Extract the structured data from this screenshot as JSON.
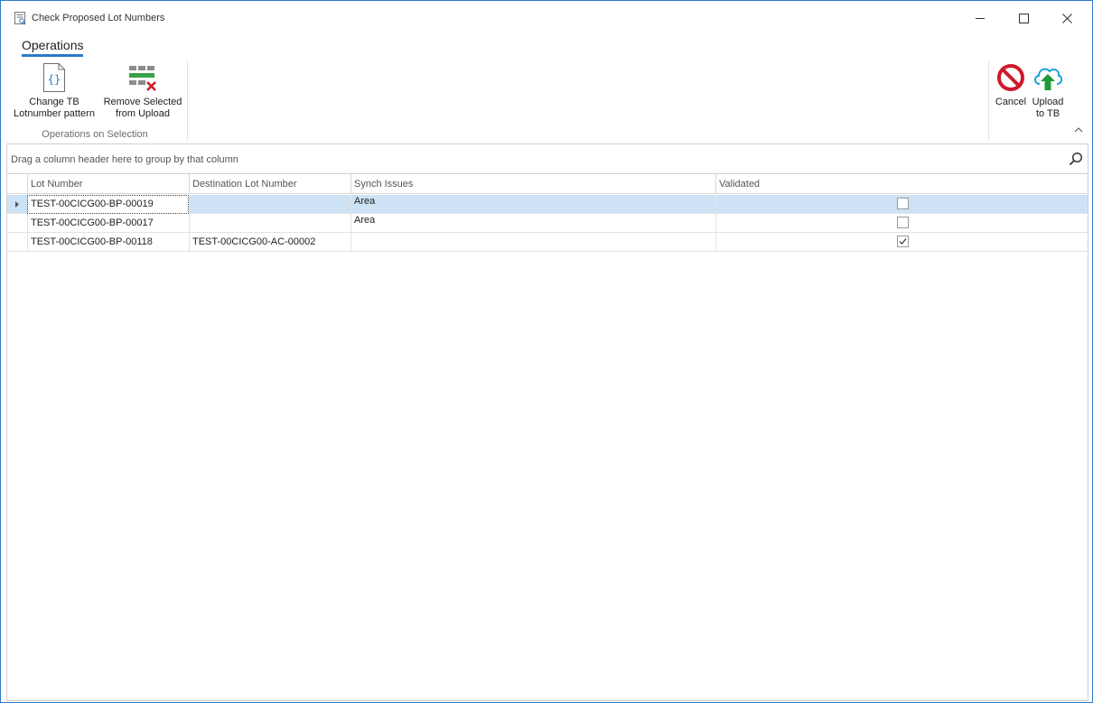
{
  "window": {
    "title": "Check Proposed Lot Numbers"
  },
  "ribbon": {
    "tab_label": "Operations",
    "group_caption": "Operations on Selection",
    "change_pattern_line1": "Change TB",
    "change_pattern_line2": "Lotnumber pattern",
    "remove_selected_line1": "Remove Selected",
    "remove_selected_line2": "from Upload",
    "cancel_label": "Cancel",
    "upload_line1": "Upload",
    "upload_line2": "to TB"
  },
  "group_panel": {
    "hint": "Drag a column header here to group by that column"
  },
  "grid": {
    "columns": [
      "Lot Number",
      "Destination Lot Number",
      "Synch Issues",
      "Validated"
    ],
    "rows": [
      {
        "lot": "TEST-00CICG00-BP-00019",
        "dest": "",
        "issues": "Area",
        "validated": false
      },
      {
        "lot": "TEST-00CICG00-BP-00017",
        "dest": "",
        "issues": "Area",
        "validated": false
      },
      {
        "lot": "TEST-00CICG00-BP-00118",
        "dest": "TEST-00CICG00-AC-00002",
        "issues": "",
        "validated": true
      }
    ]
  },
  "colors": {
    "accent": "#2b79c9",
    "selected_row": "#cde3f5",
    "cancel_red": "#d0192a",
    "upload_green": "#1f9a3a",
    "upload_blue": "#1aa0dc"
  }
}
